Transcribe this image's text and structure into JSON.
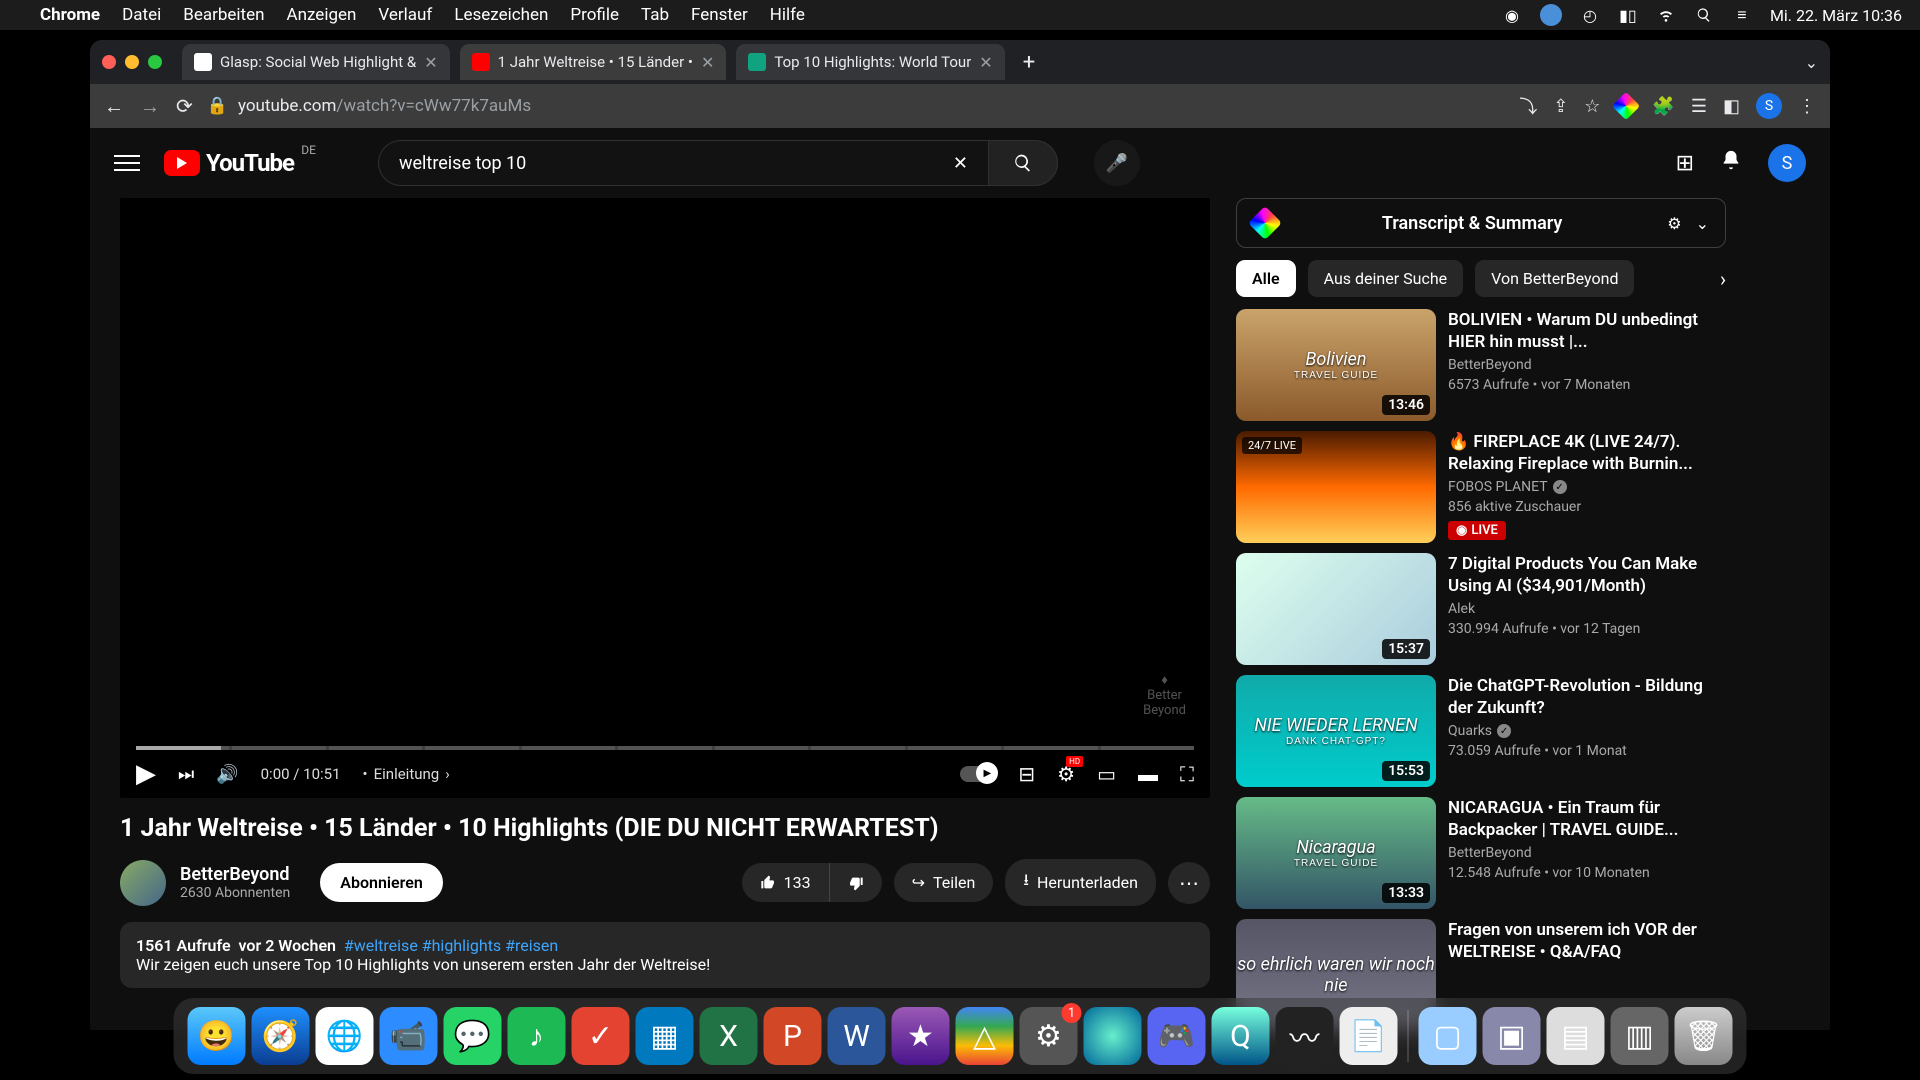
{
  "menubar": {
    "app": "Chrome",
    "items": [
      "Datei",
      "Bearbeiten",
      "Anzeigen",
      "Verlauf",
      "Lesezeichen",
      "Profile",
      "Tab",
      "Fenster",
      "Hilfe"
    ],
    "datetime": "Mi. 22. März  10:36"
  },
  "tabs": [
    {
      "title": "Glasp: Social Web Highlight &",
      "active": false
    },
    {
      "title": "1 Jahr Weltreise • 15 Länder •",
      "active": true
    },
    {
      "title": "Top 10 Highlights: World Tour",
      "active": false
    }
  ],
  "url": {
    "domain": "youtube.com",
    "path": "/watch?v=cWw77k7auMs"
  },
  "youtube": {
    "countryCode": "DE",
    "search": {
      "value": "weltreise top 10"
    },
    "avatarLetter": "S"
  },
  "player": {
    "time": "0:00 / 10:51",
    "chapter": "Einleitung",
    "watermark": "Better\nBeyond"
  },
  "video": {
    "title": "1 Jahr Weltreise • 15 Länder • 10 Highlights (DIE DU NICHT ERWARTEST)",
    "channel": "BetterBeyond",
    "subscribers": "2630 Abonnenten",
    "subscribeLabel": "Abonnieren",
    "likes": "133",
    "shareLabel": "Teilen",
    "downloadLabel": "Herunterladen",
    "views": "1561 Aufrufe",
    "age": "vor 2 Wochen",
    "hashtags": "#weltreise #highlights #reisen",
    "description": "Wir zeigen euch unsere Top 10 Highlights von unserem ersten Jahr der Weltreise!"
  },
  "sidebar": {
    "transcriptTitle": "Transcript & Summary",
    "chips": [
      "Alle",
      "Aus deiner Suche",
      "Von BetterBeyond"
    ],
    "recs": [
      {
        "title": "BOLIVIEN • Warum DU unbedingt HIER hin musst |...",
        "channel": "BetterBeyond",
        "meta": "6573 Aufrufe  • vor 7 Monaten",
        "duration": "13:46",
        "thumbText": "Bolivien",
        "subText": "TRAVEL GUIDE",
        "bg": "linear-gradient(#caa36b,#8b5a2b)"
      },
      {
        "title": "🔥 FIREPLACE 4K (LIVE 24/7). Relaxing Fireplace with Burnin...",
        "channel": "FOBOS PLANET",
        "verified": true,
        "meta": "856 aktive Zuschauer",
        "live": true,
        "liveLabel": "LIVE",
        "liveTop": "24/7 LIVE",
        "bg": "linear-gradient(#4a1a00,#ff6a00,#ffcf5a)"
      },
      {
        "title": "7 Digital Products You Can Make Using AI ($34,901/Month)",
        "channel": "Alek",
        "meta": "330.994 Aufrufe  • vor 12 Tagen",
        "duration": "15:37",
        "bg": "linear-gradient(135deg,#dfe,#acd)"
      },
      {
        "title": "Die ChatGPT-Revolution - Bildung der Zukunft?",
        "channel": "Quarks",
        "verified": true,
        "meta": "73.059 Aufrufe  • vor 1 Monat",
        "duration": "15:53",
        "thumbText": "NIE WIEDER LERNEN",
        "subText": "DANK CHAT-GPT?",
        "bg": "linear-gradient(#1aa,#0cc)"
      },
      {
        "title": "NICARAGUA • Ein Traum für Backpacker | TRAVEL GUIDE...",
        "channel": "BetterBeyond",
        "meta": "12.548 Aufrufe  • vor 10 Monaten",
        "duration": "13:33",
        "thumbText": "Nicaragua",
        "subText": "TRAVEL GUIDE",
        "bg": "linear-gradient(#6b8,#356)"
      },
      {
        "title": "Fragen von unserem ich VOR der WELTREISE • Q&A/FAQ",
        "channel": "",
        "meta": "",
        "bg": "linear-gradient(#556,#778)",
        "thumbText": "so ehrlich waren wir   noch nie"
      }
    ]
  }
}
